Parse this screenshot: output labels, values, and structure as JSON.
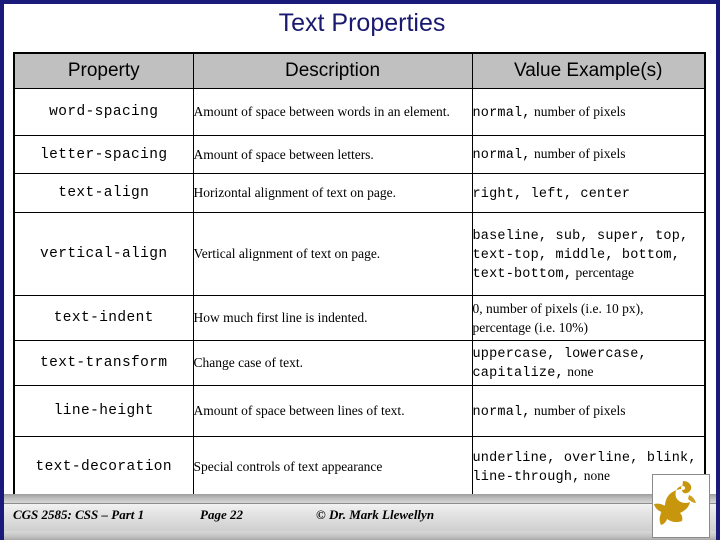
{
  "slide": {
    "title": "Text Properties",
    "title_color": "#191970",
    "border_color": "#1a1a7a",
    "header_fill": "#c0c0c0"
  },
  "table": {
    "headers": [
      "Property",
      "Description",
      "Value Example(s)"
    ],
    "rows": [
      {
        "property": "word-spacing",
        "description": "Amount of space between words in an element.",
        "values_mono": "normal,",
        "values_serif": " number of pixels"
      },
      {
        "property": "letter-spacing",
        "description": "Amount of space between letters.",
        "values_mono": "normal,",
        "values_serif": " number of pixels"
      },
      {
        "property": "text-align",
        "description": "Horizontal alignment of text on page.",
        "values_mono": "right, left, center",
        "values_serif": ""
      },
      {
        "property": "vertical-align",
        "description": "Vertical alignment of text on page.",
        "values_mono": "baseline, sub, super, top, text-top, middle, bottom, text-bottom,",
        "values_serif": " percentage"
      },
      {
        "property": "text-indent",
        "description": "How much first line is indented.",
        "values_mono": "",
        "values_serif": "0, number of pixels (i.e. 10 px), percentage (i.e. 10%)"
      },
      {
        "property": "text-transform",
        "description": "Change case of text.",
        "values_mono": "uppercase, lowercase, capitalize,",
        "values_serif": " none"
      },
      {
        "property": "line-height",
        "description": "Amount of space between lines of text.",
        "values_mono": "normal,",
        "values_serif": " number of pixels"
      },
      {
        "property": "text-decoration",
        "description": "Special controls of text appearance",
        "values_mono": "underline, overline, blink, line-through,",
        "values_serif": " none"
      }
    ]
  },
  "footer": {
    "course": "CGS 2585: CSS – Part 1",
    "page": "Page 22",
    "copyright": "© Dr. Mark Llewellyn",
    "logo_color": "#c8960c"
  }
}
